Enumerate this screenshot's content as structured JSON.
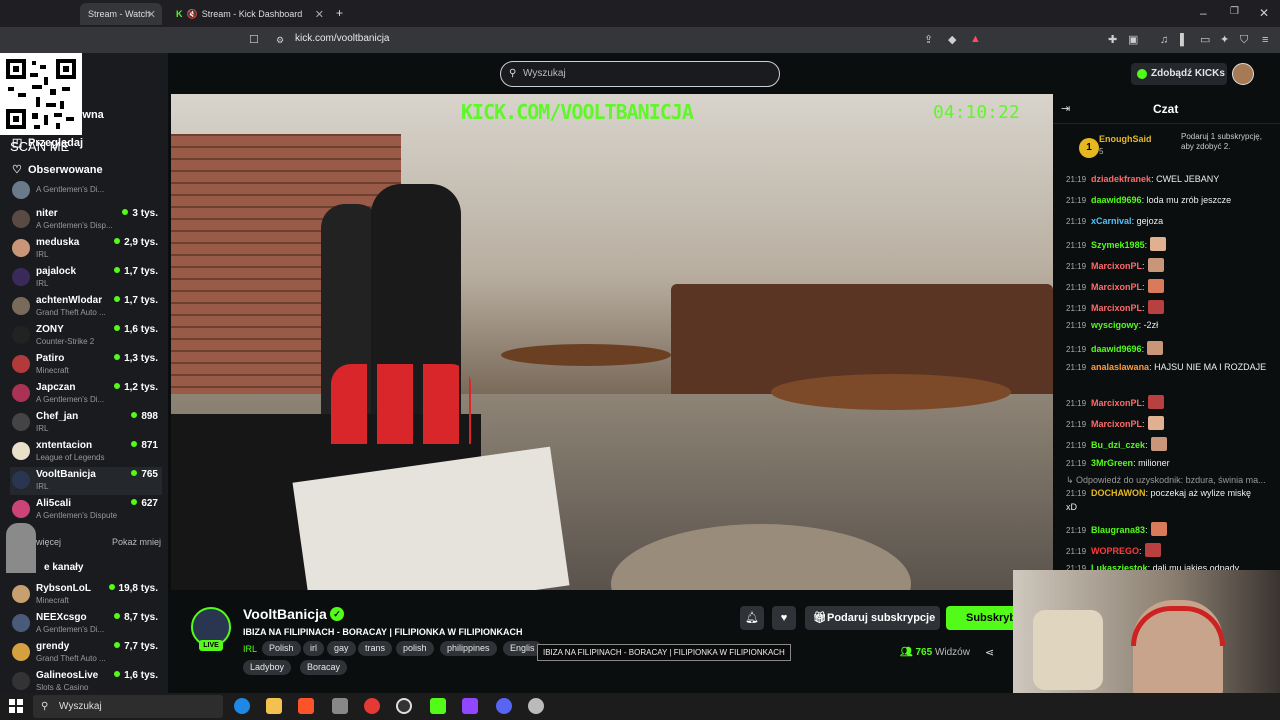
{
  "browser": {
    "tabs": [
      {
        "label": "Stream - Watch",
        "active": true
      },
      {
        "label": "Stream - Kick Dashboard",
        "active": false
      }
    ],
    "new_tab": "+",
    "url": "kick.com/vooltbanicja",
    "window_controls": [
      "–",
      "❐",
      "✕"
    ]
  },
  "kick": {
    "search_placeholder": "Wyszukaj",
    "kicks_button": "Zdobądź KICKs",
    "scan_me": "SCAN ME"
  },
  "sidebar": {
    "nav": [
      {
        "icon": "home-icon",
        "label": "Strona główna"
      },
      {
        "icon": "browse-icon",
        "label": "Przeglądaj"
      },
      {
        "icon": "heart-icon",
        "label": "Obserwowane"
      }
    ],
    "channels": [
      {
        "name": "",
        "category": "A Gentlemen's Di...",
        "viewers": ""
      },
      {
        "name": "niter",
        "category": "A Gentlemen's Disp...",
        "viewers": "3 tys."
      },
      {
        "name": "meduska",
        "category": "IRL",
        "viewers": "2,9 tys."
      },
      {
        "name": "pajalock",
        "category": "IRL",
        "viewers": "1,7 tys."
      },
      {
        "name": "achtenWlodar",
        "category": "Grand Theft Auto ...",
        "viewers": "1,7 tys."
      },
      {
        "name": "ZONY",
        "category": "Counter-Strike 2",
        "viewers": "1,6 tys."
      },
      {
        "name": "Patiro",
        "category": "Minecraft",
        "viewers": "1,3 tys."
      },
      {
        "name": "Japczan",
        "category": "A Gentlemen's Di...",
        "viewers": "1,2 tys."
      },
      {
        "name": "Chef_jan",
        "category": "IRL",
        "viewers": "898"
      },
      {
        "name": "xntentacion",
        "category": "League of Legends",
        "viewers": "871"
      },
      {
        "name": "VooltBanicja",
        "category": "IRL",
        "viewers": "765"
      },
      {
        "name": "Ali5cali",
        "category": "A Gentlemen's Dispute",
        "viewers": "627"
      }
    ],
    "show_more": "więcej",
    "show_less": "Pokaż mniej",
    "recommended_title": "e kanały",
    "recommended": [
      {
        "name": "RybsonLoL",
        "category": "Minecraft",
        "viewers": "19,8 tys."
      },
      {
        "name": "NEEXcsgo",
        "category": "A Gentlemen's Di...",
        "viewers": "8,7 tys."
      },
      {
        "name": "grendy",
        "category": "Grand Theft Auto ...",
        "viewers": "7,7 tys."
      },
      {
        "name": "GalineosLive",
        "category": "Slots & Casino",
        "viewers": "1,6 tys."
      }
    ]
  },
  "video": {
    "watermark": "KICK.COM/VOOLTBANICJA",
    "timer": "04:10:22"
  },
  "stream": {
    "name": "VooltBanicja",
    "live": "LIVE",
    "title": "IBIZA NA FILIPINACH - BORACAY | FILIPIONKA W FILIPIONKACH",
    "category": "IRL",
    "tags": [
      "Polish",
      "irl",
      "gay",
      "trans",
      "polish",
      "philippines",
      "Englis",
      "Ladyboy",
      "Boracay"
    ],
    "tooltip": "IBIZA NA FILIPINACH - BORACAY | FILIPIONKA W FILIPIONKACH",
    "gift_label": "Podaruj subskrypcje",
    "subscribe_label": "Subskrybuj",
    "viewers": "765",
    "viewers_label": "Widzów"
  },
  "chat": {
    "title": "Czat",
    "pinned": {
      "rank": "1",
      "user": "EnoughSaid",
      "count": "5",
      "text": "Podaruj 1 subskrypcję, aby zdobyć 2."
    },
    "messages": [
      {
        "time": "21:19",
        "user": "dziadekfranek",
        "color": "#ff6a6a",
        "text": ": CWEL JEBANY"
      },
      {
        "time": "21:19",
        "user": "daawid9696",
        "color": "#53fc18",
        "text": ": loda mu zrób jeszcze"
      },
      {
        "time": "21:19",
        "user": "xCarnival",
        "color": "#4fc3ff",
        "text": ": gejoza"
      },
      {
        "time": "21:19",
        "user": "Szymek1985",
        "color": "#53fc18",
        "text": ":",
        "emote": true
      },
      {
        "time": "21:19",
        "user": "MarcixonPL",
        "color": "#ff6a6a",
        "text": ":",
        "emote": true
      },
      {
        "time": "21:19",
        "user": "MarcixonPL",
        "color": "#ff6a6a",
        "text": ":",
        "emote": true
      },
      {
        "time": "21:19",
        "user": "MarcixonPL",
        "color": "#ff6a6a",
        "text": ":",
        "emote": true
      },
      {
        "time": "21:19",
        "user": "wyscigowy",
        "color": "#53fc18",
        "text": ": -2zł"
      },
      {
        "time": "21:19",
        "user": "daawid9696",
        "color": "#53fc18",
        "text": ":",
        "emote": true
      },
      {
        "time": "21:19",
        "user": "analaslawana",
        "color": "#ff9a3c",
        "text": ": HAJSU NIE MA I ROZDAJE"
      },
      {
        "time": "21:19",
        "user": "MarcixonPL",
        "color": "#ff6a6a",
        "text": ":",
        "emote": true
      },
      {
        "time": "21:19",
        "user": "MarcixonPL",
        "color": "#ff6a6a",
        "text": ":",
        "emote": true
      },
      {
        "time": "21:19",
        "user": "Bu_dzi_czek",
        "color": "#53fc18",
        "text": ":",
        "emote": true
      },
      {
        "time": "21:19",
        "user": "3MrGreen",
        "color": "#53fc18",
        "text": ": milioner"
      },
      {
        "time": "",
        "user": "",
        "color": "#999",
        "text": "↳ Odpowiedź do uzyskodnik: bzdura, świnia ma..."
      },
      {
        "time": "21:19",
        "user": "DOCHAWON",
        "color": "#e5b823",
        "text": ": poczekaj aż wylize miskę"
      },
      {
        "time": "",
        "user": "",
        "color": "#eee",
        "text": "xD"
      },
      {
        "time": "21:19",
        "user": "Blaugrana83",
        "color": "#53fc18",
        "text": ":",
        "emote": true
      },
      {
        "time": "21:19",
        "user": "WOPREGO",
        "color": "#ff3a3a",
        "text": ":",
        "emote": true
      },
      {
        "time": "21:19",
        "user": "Lukaszjestok",
        "color": "#53fc18",
        "text": ": dali mu jakies odpady"
      }
    ]
  },
  "taskbar": {
    "search_label": "Wyszukaj"
  }
}
